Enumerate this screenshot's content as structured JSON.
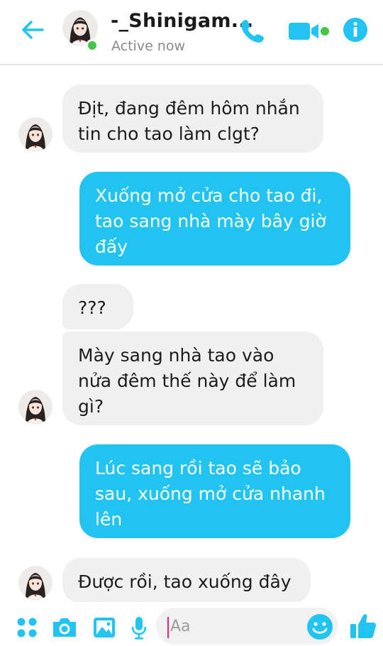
{
  "header": {
    "contact_name": "-_Shinigam...",
    "status": "Active now"
  },
  "messages": [
    {
      "side": "in",
      "lines": [
        "Địt, đang đêm hôm nhắn",
        "tin cho tao làm clgt?"
      ]
    },
    {
      "side": "out",
      "lines": [
        "Xuống mở cửa cho tao đi,",
        "tao sang nhà mày bây giờ",
        "đấy"
      ]
    },
    {
      "side": "in",
      "lines": [
        "???"
      ]
    },
    {
      "side": "in",
      "lines": [
        "Mày sang nhà tao vào",
        "nửa đêm thế này để làm",
        "gì?"
      ]
    },
    {
      "side": "out",
      "lines": [
        "Lúc sang rồi tao sẽ bảo",
        "sau, xuống mở cửa nhanh",
        "lên"
      ]
    },
    {
      "side": "in",
      "lines": [
        "Được rồi, tao xuống đây"
      ]
    }
  ],
  "composer": {
    "placeholder": "Aa"
  },
  "colors": {
    "accent": "#21c4f0",
    "online": "#44c544",
    "incoming_bubble": "#f0f0f0"
  },
  "icons": [
    "back-arrow-icon",
    "phone-icon",
    "video-icon",
    "info-icon",
    "apps-icon",
    "camera-icon",
    "gallery-icon",
    "microphone-icon",
    "emoji-icon",
    "thumbs-up-icon"
  ]
}
